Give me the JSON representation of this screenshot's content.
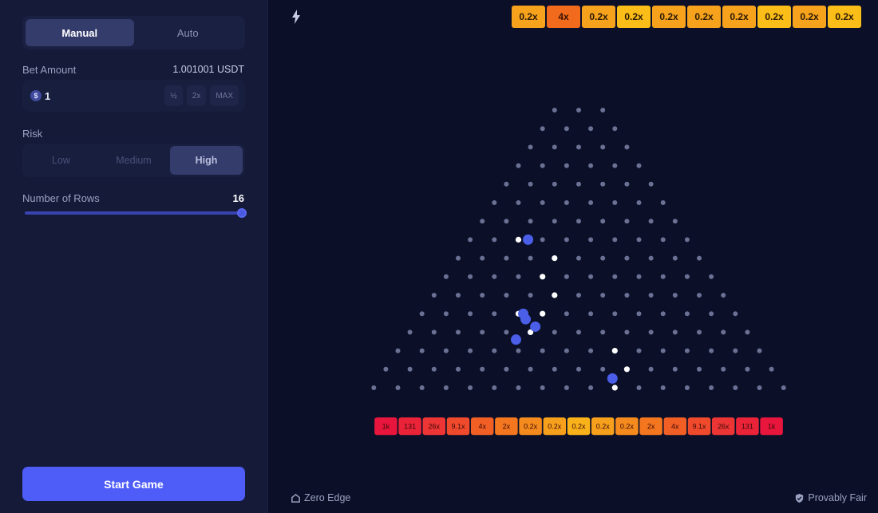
{
  "sidebar": {
    "modes": [
      "Manual",
      "Auto"
    ],
    "active_mode": "Manual",
    "bet_label": "Bet Amount",
    "balance": "1.001001 USDT",
    "bet_value": "1",
    "currency_symbol": "$",
    "bet_buttons": [
      "½",
      "2x",
      "MAX"
    ],
    "risk_label": "Risk",
    "risks": [
      "Low",
      "Medium",
      "High"
    ],
    "active_risk": "High",
    "rows_label": "Number of Rows",
    "rows_value": "16",
    "start_label": "Start Game"
  },
  "history": [
    "0.2x",
    "4x",
    "0.2x",
    "0.2x",
    "0.2x",
    "0.2x",
    "0.2x",
    "0.2x",
    "0.2x",
    "0.2x"
  ],
  "board": {
    "rows": 16,
    "multipliers": [
      "1k",
      "131",
      "26x",
      "9.1x",
      "4x",
      "2x",
      "0.2x",
      "0.2x",
      "0.2x",
      "0.2x",
      "0.2x",
      "2x",
      "4x",
      "9.1x",
      "26x",
      "131",
      "1k"
    ],
    "bucket_colors": [
      "#e8153c",
      "#eb2338",
      "#ee3535",
      "#f04a2c",
      "#f25f25",
      "#f4761f",
      "#f58a1d",
      "#f7a01c",
      "#f9b21a",
      "#f7a01c",
      "#f58a1d",
      "#f4761f",
      "#f25f25",
      "#f04a2c",
      "#ee3535",
      "#eb2338",
      "#e8153c"
    ],
    "highlight_pegs": [
      [
        7,
        2
      ],
      [
        8,
        4
      ],
      [
        9,
        4
      ],
      [
        10,
        5
      ],
      [
        11,
        5
      ],
      [
        12,
        5
      ],
      [
        13,
        9
      ],
      [
        14,
        10
      ],
      [
        15,
        10
      ],
      [
        11,
        4
      ]
    ],
    "balls": [
      [
        7,
        2.4
      ],
      [
        11,
        4.2
      ],
      [
        11.3,
        4.3
      ],
      [
        11.7,
        4.7
      ],
      [
        12.4,
        4.4
      ],
      [
        14.5,
        9.4
      ]
    ]
  },
  "footer": {
    "left": "Zero Edge",
    "right": "Provably Fair"
  },
  "colors": {
    "accent": "#4e5cf8",
    "ball": "#4a5ee8",
    "peg": "#6b7194",
    "peg_active": "#ffffff"
  }
}
